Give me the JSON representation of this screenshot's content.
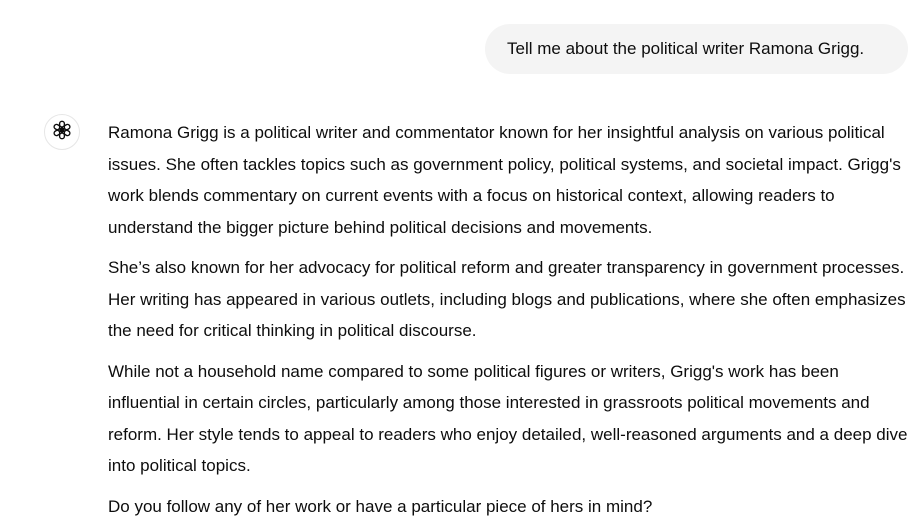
{
  "user_message": "Tell me about the political writer Ramona Grigg.",
  "assistant": {
    "avatar_icon": "openai-logo-icon",
    "paragraphs": [
      "Ramona Grigg is a political writer and commentator known for her insightful analysis on various political issues. She often tackles topics such as government policy, political systems, and societal impact. Grigg's work blends commentary on current events with a focus on historical context, allowing readers to understand the bigger picture behind political decisions and movements.",
      "She’s also known for her advocacy for political reform and greater transparency in government processes. Her writing has appeared in various outlets, including blogs and publications, where she often emphasizes the need for critical thinking in political discourse.",
      "While not a household name compared to some political figures or writers, Grigg's work has been influential in certain circles, particularly among those interested in grassroots political movements and reform. Her style tends to appeal to readers who enjoy detailed, well-reasoned arguments and a deep dive into political topics.",
      "Do you follow any of her work or have a particular piece of hers in mind?"
    ]
  },
  "colors": {
    "user_bubble_bg": "#f4f4f4",
    "text": "#0d0d0d",
    "background": "#ffffff"
  }
}
